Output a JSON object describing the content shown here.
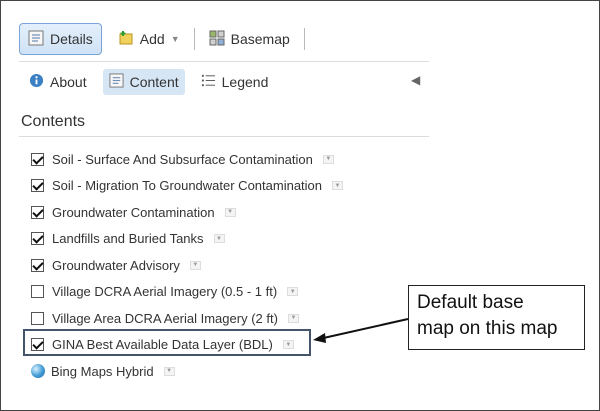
{
  "toolbar": {
    "details_label": "Details",
    "add_label": "Add",
    "basemap_label": "Basemap"
  },
  "subtabs": {
    "about_label": "About",
    "content_label": "Content",
    "legend_label": "Legend"
  },
  "contents_title": "Contents",
  "layers": [
    {
      "label": "Soil - Surface And Subsurface Contamination",
      "checked": true
    },
    {
      "label": "Soil - Migration To Groundwater Contamination",
      "checked": true
    },
    {
      "label": "Groundwater Contamination",
      "checked": true
    },
    {
      "label": "Landfills and Buried Tanks",
      "checked": true
    },
    {
      "label": "Groundwater Advisory",
      "checked": true
    },
    {
      "label": "Village DCRA Aerial Imagery (0.5 - 1 ft)",
      "checked": false
    },
    {
      "label": "Village Area DCRA Aerial Imagery (2 ft)",
      "checked": false
    },
    {
      "label": "GINA Best Available Data Layer (BDL)",
      "checked": true
    }
  ],
  "basemap_layer": {
    "label": "Bing Maps Hybrid"
  },
  "callout": {
    "line1": "Default base",
    "line2": "map on this map"
  },
  "colors": {
    "accent": "#7aa3d6",
    "active_tab": "#d6e6f5",
    "highlight_border": "#44546a"
  }
}
